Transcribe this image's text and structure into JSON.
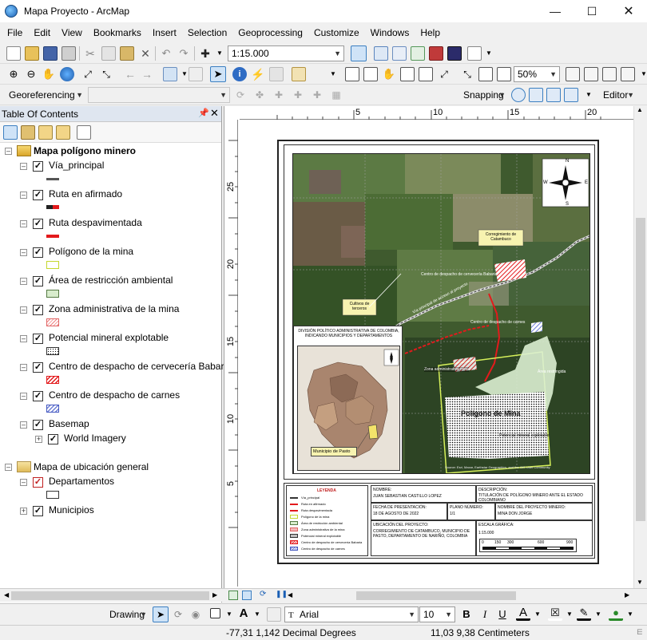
{
  "window": {
    "title": "Mapa Proyecto - ArcMap"
  },
  "menu": [
    "File",
    "Edit",
    "View",
    "Bookmarks",
    "Insert",
    "Selection",
    "Geoprocessing",
    "Customize",
    "Windows",
    "Help"
  ],
  "toolbar": {
    "scale": "1:15.000",
    "georeferencing": "Georeferencing",
    "zoom": "50%",
    "snapping": "Snapping",
    "editor": "Editor"
  },
  "toc": {
    "title": "Table Of Contents",
    "dataframes": [
      {
        "name": "Mapa polígono minero",
        "layers": [
          {
            "name": "Vía_principal"
          },
          {
            "name": "Ruta en afirmado"
          },
          {
            "name": "Ruta despavimentada"
          },
          {
            "name": "Polígono de la mina"
          },
          {
            "name": "Área de restricción ambiental"
          },
          {
            "name": "Zona administrativa de la mina"
          },
          {
            "name": "Potencial mineral explotable"
          },
          {
            "name": "Centro de despacho de cervecería Babaria"
          },
          {
            "name": "Centro de despacho de carnes"
          },
          {
            "name": "Basemap"
          }
        ],
        "sublayer": "World Imagery"
      },
      {
        "name": "Mapa de ubicación general",
        "layers": [
          {
            "name": "Departamentos"
          },
          {
            "name": "Municipios"
          }
        ]
      }
    ]
  },
  "ruler": {
    "h": [
      "5",
      "10",
      "15",
      "20"
    ],
    "v": [
      "25",
      "20",
      "15",
      "10",
      "5"
    ]
  },
  "map": {
    "labels": {
      "corregimiento": "Corregimiento de Catambuco",
      "cultivos": "Cultivos de terceros",
      "centro_cerveceria": "Centro de despacho de cervecería Babaria",
      "centro_carnes": "Centro de despacho de carnes",
      "via": "Vía principal de acceso al proyecto",
      "zona_admin": "Zona administrativa mina",
      "area_restr": "Área restringida",
      "poligono": "Polígono de Mina",
      "potencial": "Potencial mineral explotable",
      "credits": "Source: Esri, Maxar, Earthstar Geographics, and the GIS User Community"
    },
    "compass": {
      "n": "N",
      "s": "S",
      "e": "E",
      "w": "W"
    },
    "inset": {
      "title": "DIVISIÓN POLÍTICO ADMINISTRATIVA DE COLOMBIA, INDICANDO MUNICIPIOS Y DEPARTAMENTOS",
      "municipio": "Municipio de Pasto"
    },
    "leyenda": {
      "title": "LEYENDA",
      "items": [
        "Vía_principal",
        "Ruta en afirmado",
        "Ruta despavimentada",
        "Polígono de la mina",
        "Área de restricción ambiental",
        "Zona administrativa de la mina",
        "Potencial mineral explotable",
        "Centro de despacho de cervecería Babaria",
        "Centro de despacho de carnes"
      ]
    },
    "info": {
      "nombre_lbl": "NOMBRE:",
      "nombre": "JUAN SEBASTIAN CASTILLO LOPEZ",
      "desc_lbl": "DESCRIPCIÓN:",
      "desc": "TITULACIÓN DE POLÍGONO MINERO ANTE EL ESTADO COLOMBIANO",
      "fecha_lbl": "FECHA DE PRESENTACIÓN:",
      "fecha": "18 DE AGOSTO DE 2022",
      "plano_lbl": "PLANO NÚMERO:",
      "plano": "1/1",
      "proy_lbl": "NOMBRE DEL PROYECTO MINERO:",
      "proy": "MINA DON JORGE",
      "ubic_lbl": "UBICACIÓN DEL PROYECTO:",
      "ubic": "CORREGIMIENTO DE CATAMBUCO, MUNICIPIO DE PASTO, DEPARTAMENTO DE NARIÑO, COLOMBIA",
      "escala_lbl": "ESCALA GRÁFICA:",
      "escala": "1:15.000",
      "bar_ticks": [
        "0",
        "150",
        "300",
        "600",
        "900"
      ]
    }
  },
  "draw": {
    "drawing": "Drawing",
    "font": "Arial",
    "size": "10"
  },
  "status": {
    "coords": "-77,31  1,142 Decimal Degrees",
    "page": "11,03  9,38 Centimeters"
  },
  "colors": {
    "ruta_afirmado": "#e31a1c",
    "ruta_despav": "#e31a1c",
    "poligono": "#e8f58c",
    "restr": "#d8eccc",
    "admin": "#f4b8b8",
    "carnes": "#6e7fd6"
  }
}
